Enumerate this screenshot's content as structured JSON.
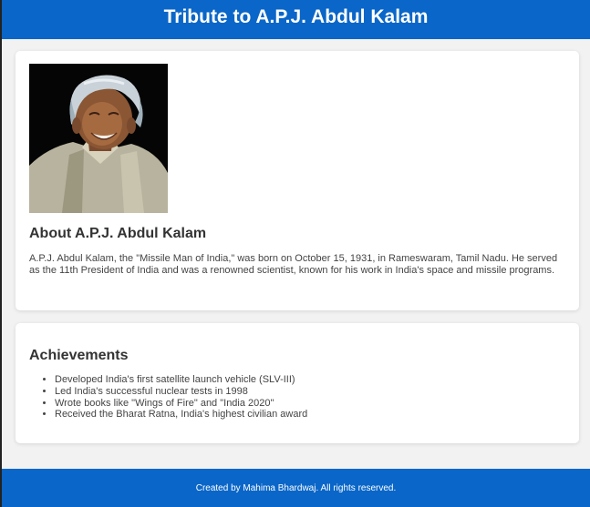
{
  "header": {
    "title": "Tribute to A.P.J. Abdul Kalam"
  },
  "about": {
    "portrait_alt": "portrait of A.P.J. Abdul Kalam",
    "title": "About A.P.J. Abdul Kalam",
    "text": "A.P.J. Abdul Kalam, the \"Missile Man of India,\" was born on October 15, 1931, in Rameswaram, Tamil Nadu. He served as the 11th President of India and was a renowned scientist, known for his work in India's space and missile programs."
  },
  "achievements": {
    "title": "Achievements",
    "items": [
      "Developed India's first satellite launch vehicle (SLV-III)",
      "Led India's successful nuclear tests in 1998",
      "Wrote books like \"Wings of Fire\" and \"India 2020\"",
      "Received the Bharat Ratna, India's highest civilian award"
    ]
  },
  "footer": {
    "text": "Created by Mahima Bhardwaj. All rights reserved."
  },
  "colors": {
    "brand": "#0a66c8",
    "background": "#f2f2f2",
    "card": "#ffffff"
  }
}
